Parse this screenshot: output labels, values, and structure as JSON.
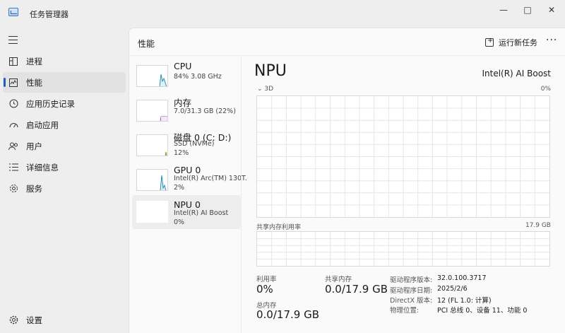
{
  "app": {
    "title": "任务管理器"
  },
  "window_controls": {
    "minimize": "—",
    "maximize": "□",
    "close": "✕"
  },
  "nav": {
    "items": [
      {
        "label": "进程",
        "icon": "processes-icon"
      },
      {
        "label": "性能",
        "icon": "performance-icon"
      },
      {
        "label": "应用历史记录",
        "icon": "app-history-icon"
      },
      {
        "label": "启动应用",
        "icon": "startup-icon"
      },
      {
        "label": "用户",
        "icon": "users-icon"
      },
      {
        "label": "详细信息",
        "icon": "details-icon"
      },
      {
        "label": "服务",
        "icon": "services-icon"
      }
    ],
    "selected": "性能",
    "settings_label": "设置"
  },
  "header": {
    "title": "性能",
    "run_task_label": "运行新任务",
    "more_label": "···"
  },
  "devices": [
    {
      "name": "CPU",
      "lines": [
        "84%  3.08 GHz"
      ],
      "color": "#2a8fb8"
    },
    {
      "name": "内存",
      "lines": [
        "7.0/31.3 GB (22%)"
      ],
      "color": "#9b4fb5"
    },
    {
      "name": "磁盘 0 (C: D:)",
      "lines": [
        "SSD (NVMe)",
        "12%"
      ],
      "color": "#6f9a1f"
    },
    {
      "name": "GPU 0",
      "lines": [
        "Intel(R) Arc(TM) 130T.",
        "2%"
      ],
      "color": "#2a8fb8"
    },
    {
      "name": "NPU 0",
      "lines": [
        "Intel(R) AI Boost",
        "0%"
      ],
      "color": "#2a8fb8"
    }
  ],
  "detail": {
    "title": "NPU",
    "device_name": "Intel(R) AI Boost",
    "chart1": {
      "label": "3D",
      "max": "0%"
    },
    "chart2": {
      "label": "共享内存利用率",
      "max": "17.9 GB"
    },
    "stats": {
      "utilization_label": "利用率",
      "utilization_value": "0%",
      "shared_mem_label": "共享内存",
      "shared_mem_value": "0.0/17.9 GB",
      "total_mem_label": "总内存",
      "total_mem_value": "0.0/17.9 GB"
    },
    "info": [
      {
        "k": "驱动程序版本:",
        "v": "32.0.100.3717"
      },
      {
        "k": "驱动程序日期:",
        "v": "2025/2/6"
      },
      {
        "k": "DirectX 版本:",
        "v": "12 (FL 1.0: 计算)"
      },
      {
        "k": "物理位置:",
        "v": "PCI 总线 0、设备 11、功能 0"
      }
    ]
  },
  "colors": {
    "accent": "#1f5fbf",
    "grid": "#e6e6e6"
  }
}
